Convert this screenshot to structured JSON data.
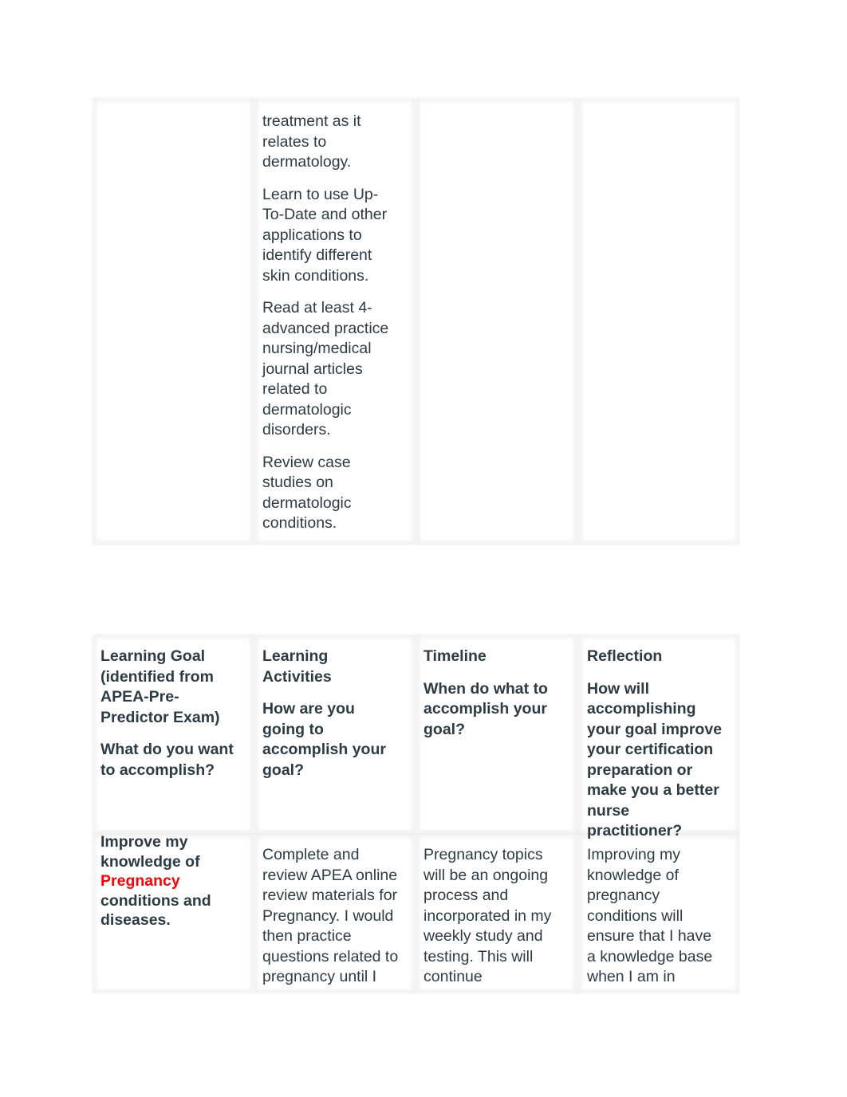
{
  "table1": {
    "col2_paragraphs": [
      [
        "treatment as it",
        "relates to",
        "dermatology."
      ],
      [
        "Learn to use Up-",
        "To-Date and other",
        "applications to",
        "identify different",
        "skin conditions."
      ],
      [
        "Read at least 4-",
        "advanced practice",
        "nursing/medical",
        "journal articles",
        "related to",
        "dermatologic",
        "disorders."
      ],
      [
        "Review case",
        "studies on",
        "dermatologic",
        "conditions."
      ]
    ]
  },
  "table2": {
    "headers": [
      {
        "paragraphs": [
          [
            "Learning Goal",
            "(identified from",
            "APEA-Pre-",
            "Predictor Exam)"
          ],
          [
            "What do you want",
            "to accomplish?"
          ]
        ]
      },
      {
        "paragraphs": [
          [
            "Learning",
            "Activities"
          ],
          [
            "How are you",
            "going to",
            "accomplish your",
            "goal?"
          ]
        ]
      },
      {
        "paragraphs": [
          [
            "Timeline"
          ],
          [
            "When do what to",
            "accomplish your",
            "goal?"
          ]
        ]
      },
      {
        "paragraphs": [
          [
            "Reflection"
          ],
          [
            "How will",
            "accomplishing",
            "your goal improve",
            "your certification",
            "preparation or",
            "make you a better",
            "nurse",
            "practitioner?"
          ]
        ]
      }
    ],
    "goal": {
      "lines": [
        "Improve my",
        "knowledge of",
        "Pregnancy",
        "conditions and",
        "diseases."
      ],
      "highlight": "Pregnancy",
      "highlight_color": "#ff0000"
    },
    "activities": [
      "Complete and",
      "review APEA online",
      "review materials for",
      "Pregnancy. I would",
      "then practice",
      "questions related to",
      "pregnancy until I"
    ],
    "timeline": [
      "Pregnancy topics",
      "will be an ongoing",
      "process and",
      "incorporated in my",
      "weekly study and",
      "testing. This will",
      "continue"
    ],
    "reflection": [
      "Improving my",
      "knowledge of",
      "pregnancy",
      "conditions will",
      "ensure that I have",
      "a knowledge base",
      "when I am in"
    ]
  }
}
